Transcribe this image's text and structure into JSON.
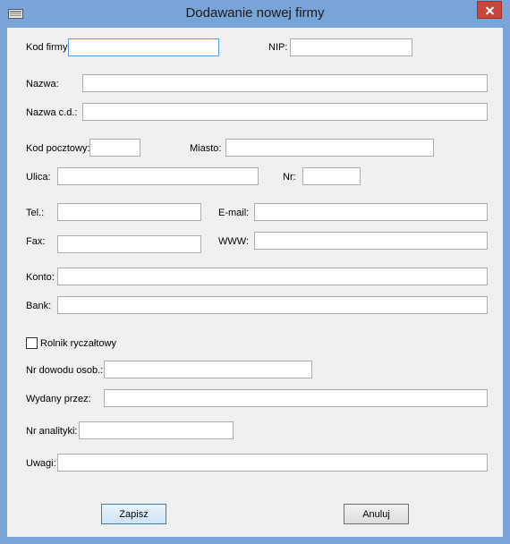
{
  "window": {
    "title": "Dodawanie nowej firmy"
  },
  "labels": {
    "kod_firmy": "Kod firmy:",
    "nip": "NIP:",
    "nazwa": "Nazwa:",
    "nazwa_cd": "Nazwa c.d.:",
    "kod_pocztowy": "Kod pocztowy:",
    "miasto": "Miasto:",
    "ulica": "Ulica:",
    "nr": "Nr:",
    "tel": "Tel.:",
    "email": "E-mail:",
    "fax": "Fax:",
    "www": "WWW:",
    "konto": "Konto:",
    "bank": "Bank:",
    "rolnik": "Rolnik ryczałtowy",
    "nr_dowodu": "Nr dowodu osob.:",
    "wydany_przez": "Wydany przez:",
    "nr_analityki": "Nr analityki:",
    "uwagi": "Uwagi:"
  },
  "values": {
    "kod_firmy": "",
    "nip": "",
    "nazwa": "",
    "nazwa_cd": "",
    "kod_pocztowy": "",
    "miasto": "",
    "ulica": "",
    "nr": "",
    "tel": "",
    "email": "",
    "fax": "",
    "www": "",
    "konto": "",
    "bank": "",
    "nr_dowodu": "",
    "wydany_przez": "",
    "nr_analityki": "",
    "uwagi": ""
  },
  "rolnik_checked": false,
  "buttons": {
    "save": "Zapisz",
    "cancel": "Anuluj"
  }
}
